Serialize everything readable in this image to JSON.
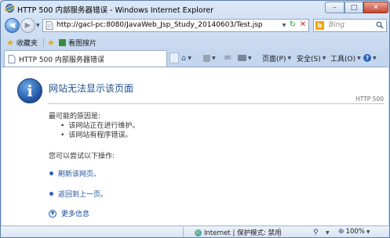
{
  "window": {
    "title": "HTTP 500 内部服务器错误 - Windows Internet Explorer",
    "minimize_label": "–",
    "maximize_label": "□",
    "close_label": "✕"
  },
  "address_bar": {
    "url": "http://gacl-pc:8080/JavaWeb_Jsp_Study_20140603/Test.jsp",
    "refresh_glyph": "↻",
    "stop_glyph": "✕"
  },
  "search": {
    "placeholder": "Bing",
    "logo_letter": "b"
  },
  "favorites_bar": {
    "favorites_label": "收藏夹",
    "link_label": "看图搜片"
  },
  "tab": {
    "title": "HTTP 500 内部服务器错误"
  },
  "command_bar": {
    "page_label": "页面(P)",
    "safety_label": "安全(S)",
    "tools_label": "工具(O)"
  },
  "content": {
    "heading": "网站无法显示该页面",
    "status_code": "HTTP 500",
    "causes_title": "最可能的原因是:",
    "causes": [
      "该网站正在进行维护。",
      "该网站有程序错误。"
    ],
    "try_title": "您可以尝试以下操作:",
    "actions": [
      "刷新该网页。",
      "返回到上一页。"
    ],
    "more_info": "更多信息"
  },
  "status_bar": {
    "zone_text": "Internet | 保护模式: 禁用",
    "zoom": "100%"
  },
  "colors": {
    "heading_blue": "#1f4f8f",
    "link_blue": "#1a4e9a",
    "chrome_blue": "#c4d6ee"
  }
}
